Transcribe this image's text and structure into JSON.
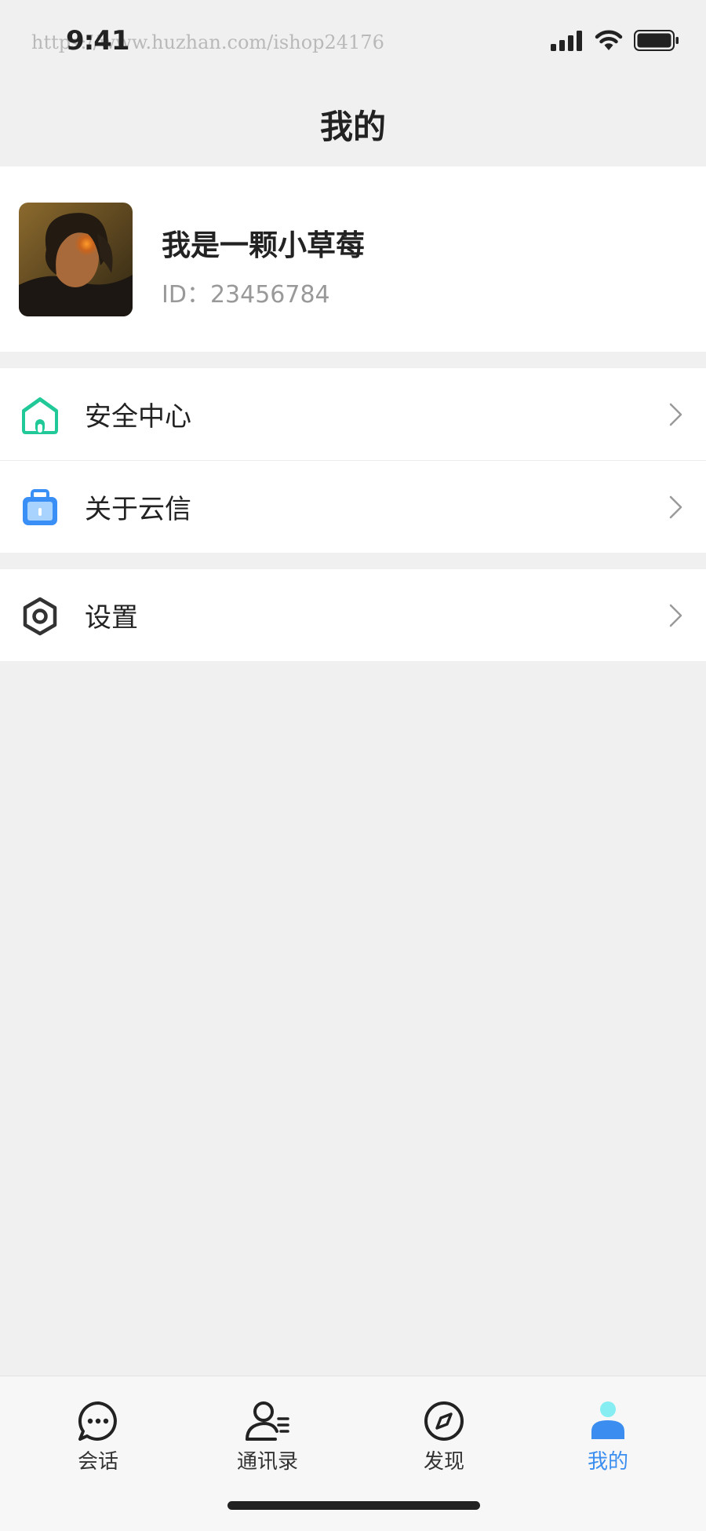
{
  "status_bar": {
    "time": "9:41",
    "watermark": "https://www.huzhan.com/ishop24176"
  },
  "header": {
    "title": "我的"
  },
  "profile": {
    "username": "我是一颗小草莓",
    "id_text": "ID：23456784"
  },
  "menu": {
    "security": {
      "label": "安全中心",
      "icon": "house-icon",
      "color": "#20c997"
    },
    "about": {
      "label": "关于云信",
      "icon": "briefcase-icon",
      "color": "#3a8ff7"
    },
    "settings": {
      "label": "设置",
      "icon": "gear-icon",
      "color": "#333333"
    }
  },
  "tabs": [
    {
      "label": "会话",
      "icon": "chat-icon"
    },
    {
      "label": "通讯录",
      "icon": "contacts-icon"
    },
    {
      "label": "发现",
      "icon": "compass-icon"
    },
    {
      "label": "我的",
      "icon": "person-icon",
      "active": true
    }
  ],
  "colors": {
    "accent": "#3b8ef0",
    "background": "#f0f0f0"
  }
}
